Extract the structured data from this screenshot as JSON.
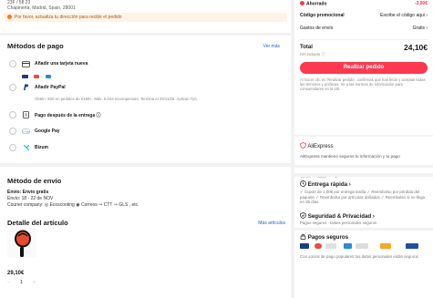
{
  "address": {
    "line": "23F / 58 23",
    "city": "Chapinería, Madrid, Spain, 28001",
    "warning": "Por favor, actualiza tu dirección para recibir el pedido"
  },
  "payment": {
    "title": "Métodos de pago",
    "see_more": "Ver más",
    "methods": [
      {
        "label": "Añadir una tarjeta nueva",
        "icon": "credit-card-icon"
      },
      {
        "label": "Añadir PayPal",
        "icon": "paypal-icon"
      },
      {
        "label": "Pago después de la entrega ⓘ",
        "icon": "invoice-icon"
      },
      {
        "label": "Google Pay",
        "icon": "google-pay-icon"
      },
      {
        "label": "Bizum",
        "icon": "bizum-icon"
      }
    ],
    "paypal_note": "Obtén -€20 en pedidos de €199+. Máx. 5.043 recompensas. Termina el 29/11/25. Aplican TyC."
  },
  "shipping": {
    "title": "Método de envío",
    "line1": "Envío: Envío gratis",
    "line2": "Envío: 18 - 22 de NOV",
    "couriers": "Courier company: ◎ Ecoscooting ◉ Correos ⇒ CTT ⇒ GLS , etc."
  },
  "item": {
    "title": "Detalle del artículo",
    "more": "Más artículos",
    "price": "29,10€",
    "qty": "1",
    "minus": "−",
    "plus": "+"
  },
  "summary": {
    "saved_label": "Ahorrado",
    "saved_value": "-3,00€",
    "promo_label": "Código promocional",
    "promo_value": "Escribe el código aqui ›",
    "shipping_label": "Gastos de envío",
    "shipping_value": "Gratis ›",
    "total_label": "Total",
    "total_value": "24,10€",
    "vat": "IVA incluido ⓘ",
    "order_button": "Realizar pedido",
    "legal": "Al hacer clic en 'Realizar pedido', confirmas que has leído y aceptas todas las términos y políticas. Ve a las normas de información para consumidores en la UE."
  },
  "trust": {
    "brand": "AliExpress",
    "text": "AliExpress mantiene seguros tu información y tu pago"
  },
  "benefits": {
    "fast_title": "Entrega rápida ›",
    "fast_text": "✓ Cupón de 1,00€ por entrega tardía ✓ Reembolso por pérdida del paquete ✓ Reembolso por artículos dañados ✓ Reembolso si no llega en 35 días",
    "security_title": "Seguridad & Privacidad ›",
    "security_text": "Pagos seguros · Datos personales seguros",
    "secure_pay_title": "Pagos seguros",
    "secure_pay_text": "Con socios de pago populares tus datos personales están seguros"
  },
  "colors": {
    "accent": "#fd384f",
    "link": "#1a5fd1",
    "warning_bg": "#fff3e6"
  }
}
